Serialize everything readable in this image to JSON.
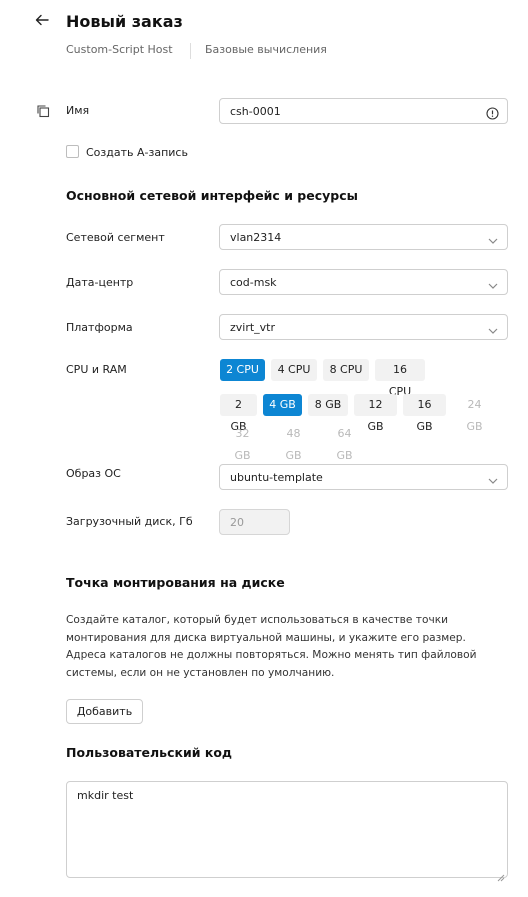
{
  "header": {
    "title": "Новый заказ",
    "breadcrumbs": [
      "Custom-Script Host",
      "Базовые вычисления"
    ]
  },
  "form": {
    "name": {
      "label": "Имя",
      "value": "csh-0001"
    },
    "create_a_record": {
      "label": "Создать А-запись",
      "checked": false
    },
    "network_section_title": "Основной сетевой интерфейс и ресурсы",
    "segment": {
      "label": "Сетевой сегмент",
      "value": "vlan2314"
    },
    "datacenter": {
      "label": "Дата-центр",
      "value": "cod-msk"
    },
    "platform": {
      "label": "Платформа",
      "value": "zvirt_vtr"
    },
    "cpu_ram": {
      "label": "CPU и RAM",
      "cpu_options": [
        "2 CPU",
        "4 CPU",
        "8 CPU",
        "16 CPU"
      ],
      "cpu_selected": "2 CPU",
      "ram_options": [
        "2 GB",
        "4 GB",
        "8 GB",
        "12 GB",
        "16 GB",
        "24 GB",
        "32 GB",
        "48 GB",
        "64 GB"
      ],
      "ram_selected": "4 GB",
      "ram_disabled": [
        "24 GB",
        "32 GB",
        "48 GB",
        "64 GB"
      ]
    },
    "os_image": {
      "label": "Образ ОС",
      "value": "ubuntu-template"
    },
    "boot_disk": {
      "label": "Загрузочный диск, Гб",
      "value": "20"
    }
  },
  "mount": {
    "title": "Точка монтирования на диске",
    "description": "Создайте каталог, который будет использоваться в качестве точки монтирования для диска виртуальной машины, и укажите его размер. Адреса каталогов не должны повторяться. Можно менять тип файловой системы, если он не установлен по умолчанию.",
    "add_label": "Добавить"
  },
  "custom_code": {
    "title": "Пользовательский код",
    "value": "mkdir test"
  },
  "colors": {
    "accent": "#0d86d3"
  }
}
